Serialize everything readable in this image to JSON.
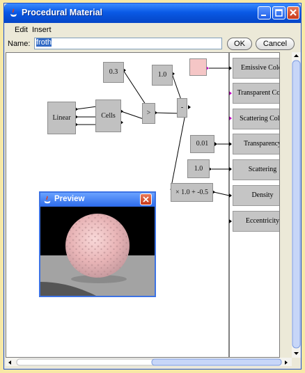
{
  "window": {
    "title": "Procedural Material"
  },
  "menu": {
    "items": [
      "Edit",
      "Insert"
    ]
  },
  "name_field": {
    "label": "Name:",
    "value": "froth"
  },
  "buttons": {
    "ok": "OK",
    "cancel": "Cancel"
  },
  "nodes": {
    "value_03": "0.3",
    "value_10": "1.0",
    "linear": "Linear",
    "cells": "Cells",
    "compare": ">",
    "subtract": "-",
    "value_001": "0.01",
    "value_10b": "1.0",
    "transform": "× 1.0 + -0.5"
  },
  "outputs": [
    "Emissive Color",
    "Transparent Color",
    "Scattering Color",
    "Transparency",
    "Scattering",
    "Density",
    "Eccentricity"
  ],
  "preview": {
    "title": "Preview"
  },
  "colors": {
    "emissive_swatch": "#f5c6c6",
    "titlebar": "#0a5ae6",
    "port_magenta": "#c000c0"
  }
}
